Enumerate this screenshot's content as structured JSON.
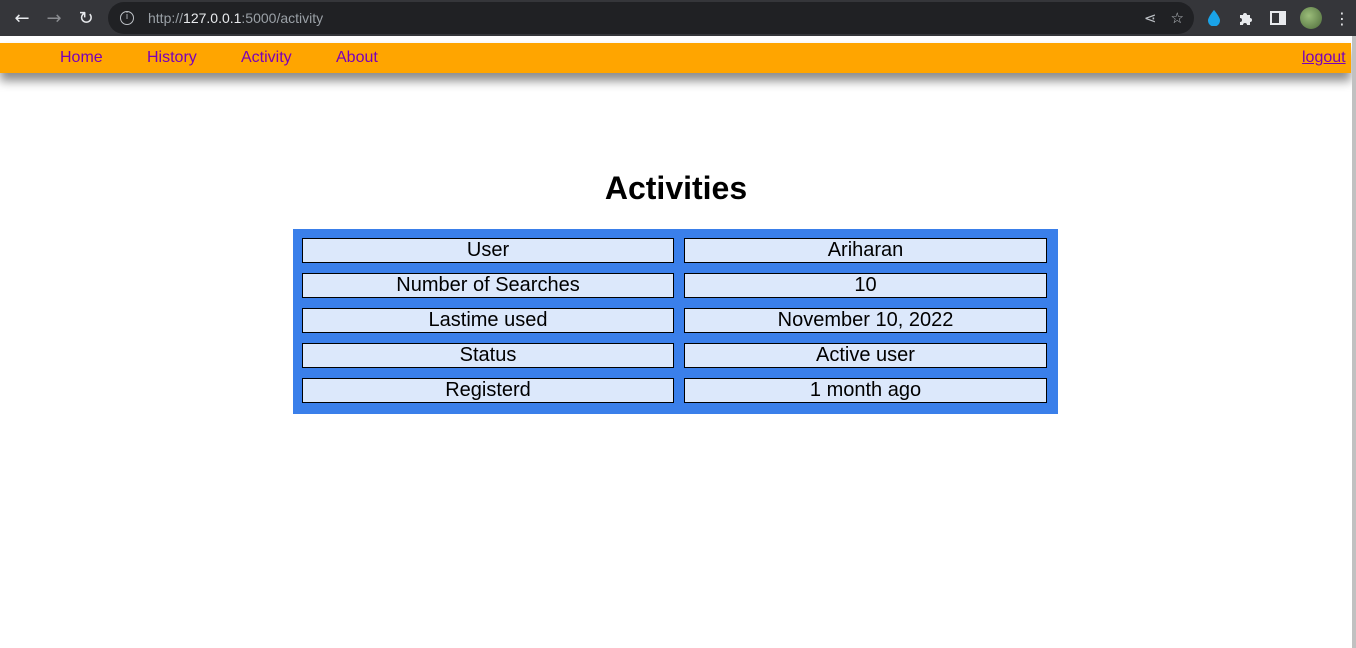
{
  "browser": {
    "url_prefix": "http://",
    "url_host": "127.0.0.1",
    "url_path": ":5000/activity",
    "back_icon": "←",
    "forward_icon": "→",
    "reload_icon": "↻",
    "share_icon": "⋖",
    "star_icon": "☆",
    "extensions": [
      "droplet-icon",
      "puzzle-icon",
      "sidepanel-icon"
    ],
    "menu_icon": "⋮"
  },
  "nav": {
    "home": "Home",
    "history": "History",
    "activity": "Activity",
    "about": "About",
    "logout": "logout",
    "link_color": "#7a00b8",
    "bar_color": "#ffa500"
  },
  "main": {
    "title": "Activities",
    "rows": [
      {
        "key": "User",
        "value": "Ariharan"
      },
      {
        "key": "Number of Searches",
        "value": "10"
      },
      {
        "key": "Lastime used",
        "value": "November 10, 2022"
      },
      {
        "key": "Status",
        "value": "Active user"
      },
      {
        "key": "Registerd",
        "value": "1 month ago"
      }
    ],
    "table_color": "#3a7fea",
    "cell_color": "#dce8fb"
  }
}
